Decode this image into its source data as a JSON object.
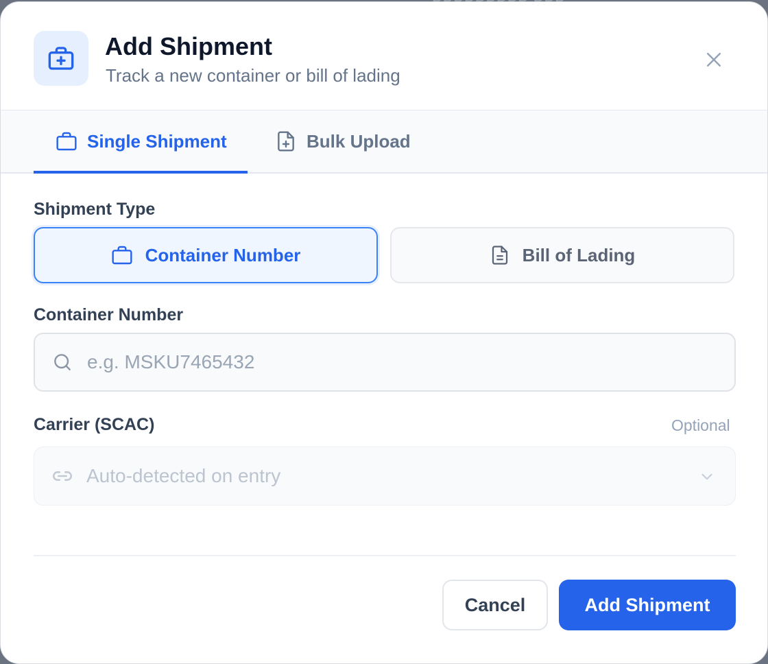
{
  "backdrop": {
    "text": "PPPPPPPPP PPP"
  },
  "header": {
    "title": "Add Shipment",
    "subtitle": "Track a new container or bill of lading"
  },
  "tabs": [
    {
      "label": "Single Shipment",
      "icon": "briefcase-icon",
      "active": true
    },
    {
      "label": "Bulk Upload",
      "icon": "file-plus-icon",
      "active": false
    }
  ],
  "form": {
    "shipment_type": {
      "label": "Shipment Type",
      "options": [
        {
          "label": "Container Number",
          "icon": "briefcase-icon",
          "selected": true
        },
        {
          "label": "Bill of Lading",
          "icon": "document-icon",
          "selected": false
        }
      ]
    },
    "container_number": {
      "label": "Container Number",
      "value": "",
      "placeholder": "e.g. MSKU7465432"
    },
    "carrier": {
      "label": "Carrier (SCAC)",
      "optional_label": "Optional",
      "placeholder": "Auto-detected on entry"
    }
  },
  "footer": {
    "cancel_label": "Cancel",
    "submit_label": "Add Shipment"
  },
  "colors": {
    "accent": "#2563eb",
    "accent_light": "#eff6ff",
    "text_dark": "#0f172a",
    "text_muted": "#64748b"
  }
}
